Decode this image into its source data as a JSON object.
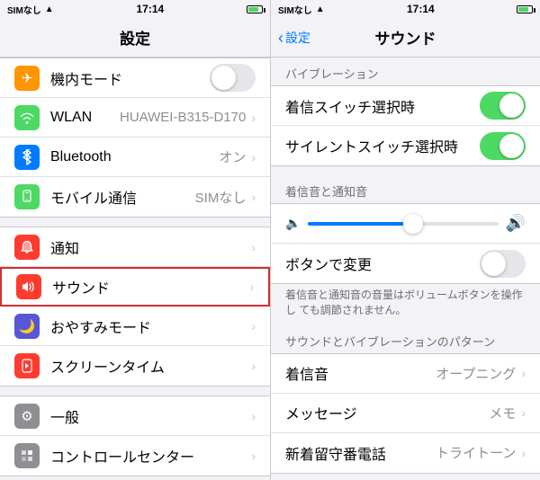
{
  "left": {
    "statusBar": {
      "carrier": "SIMなし",
      "time": "17:14",
      "wifi": true
    },
    "navTitle": "設定",
    "sections": [
      {
        "rows": [
          {
            "id": "airplane",
            "iconBg": "#ff9500",
            "iconSymbol": "✈",
            "label": "機内モード",
            "value": "",
            "hasChevron": false,
            "hasToggle": true,
            "toggleOn": false
          },
          {
            "id": "wlan",
            "iconBg": "#4cd964",
            "iconSymbol": "📶",
            "label": "WLAN",
            "value": "HUAWEI-B315-D170",
            "hasChevron": true,
            "hasToggle": false
          },
          {
            "id": "bluetooth",
            "iconBg": "#007aff",
            "iconSymbol": "𝔅",
            "label": "Bluetooth",
            "value": "オン",
            "hasChevron": true,
            "hasToggle": false
          },
          {
            "id": "mobile",
            "iconBg": "#4cd964",
            "iconSymbol": "📡",
            "label": "モバイル通信",
            "value": "SIMなし",
            "hasChevron": true,
            "hasToggle": false
          }
        ]
      },
      {
        "rows": [
          {
            "id": "notice",
            "iconBg": "#ff3b30",
            "iconSymbol": "🔔",
            "label": "通知",
            "value": "",
            "hasChevron": true,
            "hasToggle": false
          },
          {
            "id": "sound",
            "iconBg": "#ff3b30",
            "iconSymbol": "🔊",
            "label": "サウンド",
            "value": "",
            "hasChevron": true,
            "hasToggle": false,
            "highlighted": true
          },
          {
            "id": "donotdisturb",
            "iconBg": "#5856d6",
            "iconSymbol": "🌙",
            "label": "おやすみモード",
            "value": "",
            "hasChevron": true,
            "hasToggle": false
          },
          {
            "id": "screentime",
            "iconBg": "#ff3b30",
            "iconSymbol": "⏳",
            "label": "スクリーンタイム",
            "value": "",
            "hasChevron": true,
            "hasToggle": false
          }
        ]
      },
      {
        "rows": [
          {
            "id": "general",
            "iconBg": "#8e8e93",
            "iconSymbol": "⚙",
            "label": "一般",
            "value": "",
            "hasChevron": true,
            "hasToggle": false
          },
          {
            "id": "controlcenter",
            "iconBg": "#8e8e93",
            "iconSymbol": "⊞",
            "label": "コントロールセンター",
            "value": "",
            "hasChevron": true,
            "hasToggle": false
          }
        ]
      }
    ]
  },
  "right": {
    "statusBar": {
      "carrier": "SIMなし",
      "time": "17:14"
    },
    "navBack": "設定",
    "navTitle": "サウンド",
    "vibrationHeader": "バイブレーション",
    "rows": [
      {
        "id": "ring-vibrate",
        "label": "着信スイッチ選択時",
        "hasToggle": true,
        "toggleOn": true
      },
      {
        "id": "silent-vibrate",
        "label": "サイレントスイッチ選択時",
        "hasToggle": true,
        "toggleOn": true
      }
    ],
    "ringtoneHeader": "着信音と通知音",
    "sliderValue": 55,
    "ringtoneFooter": "着信音と通知音の音量はボリュームボタンを操作し\nても調節されません。",
    "changeWithButton": "ボタンで変更",
    "patternHeader": "サウンドとバイブレーションのパターン",
    "patternRows": [
      {
        "id": "ringtone",
        "label": "着信音",
        "value": "オープニング",
        "hasChevron": true
      },
      {
        "id": "message",
        "label": "メッセージ",
        "value": "メモ",
        "hasChevron": true
      },
      {
        "id": "newvoicemail",
        "label": "新着留守番電話",
        "value": "トライトーン",
        "hasChevron": true
      }
    ]
  },
  "icons": {
    "chevron": "›",
    "backChevron": "‹"
  }
}
